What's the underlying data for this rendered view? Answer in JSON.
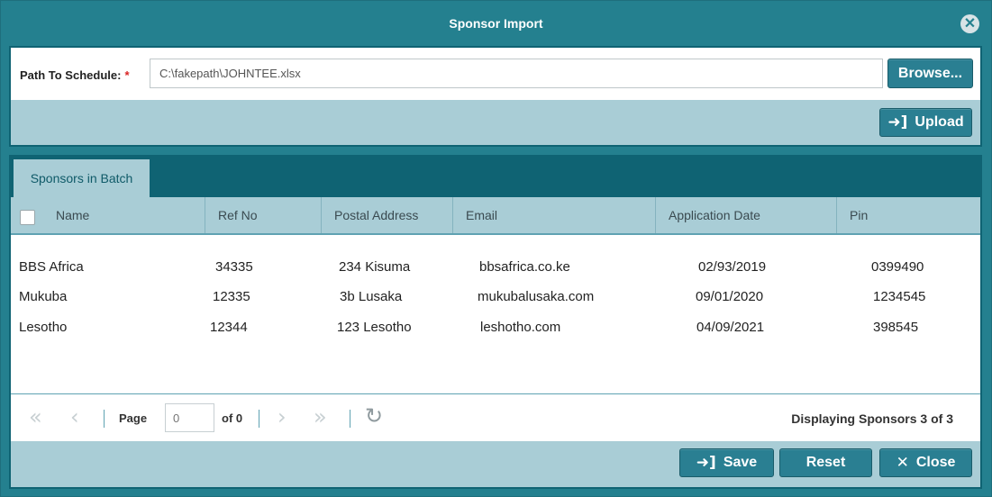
{
  "dialog": {
    "title": "Sponsor Import",
    "close_icon": "close-icon"
  },
  "import_form": {
    "path_label": "Path To Schedule:",
    "required_mark": "*",
    "path_value": "C:\\fakepath\\JOHNTEE.xlsx",
    "browse_label": "Browse...",
    "upload_label": "Upload",
    "upload_icon": "sign-in-icon"
  },
  "tabs": [
    {
      "label": "Sponsors in Batch",
      "active": true
    }
  ],
  "grid": {
    "columns": [
      "Name",
      "Ref No",
      "Postal Address",
      "Email",
      "Application Date",
      "Pin"
    ],
    "rows": [
      [
        "BBS Africa",
        "34335",
        "234 Kisuma",
        "bbsafrica.co.ke",
        "02/93/2019",
        "0399490"
      ],
      [
        "Mukuba",
        "12335",
        "3b Lusaka",
        "mukubalusaka.com",
        "09/01/2020",
        "1234545"
      ],
      [
        "Lesotho",
        "12344",
        "123 Lesotho",
        "leshotho.com",
        "04/09/2021",
        "398545"
      ]
    ]
  },
  "pager": {
    "page_label": "Page",
    "page_placeholder": "0",
    "of_label": "of 0",
    "display_text": "Displaying Sponsors 3 of 3"
  },
  "footer": {
    "save_label": "Save",
    "reset_label": "Reset",
    "close_label": "Close"
  },
  "colors": {
    "window": "#24808f",
    "panel_border": "#0f6373",
    "header_bg": "#a9cdd6",
    "button": "#2a7f92"
  }
}
